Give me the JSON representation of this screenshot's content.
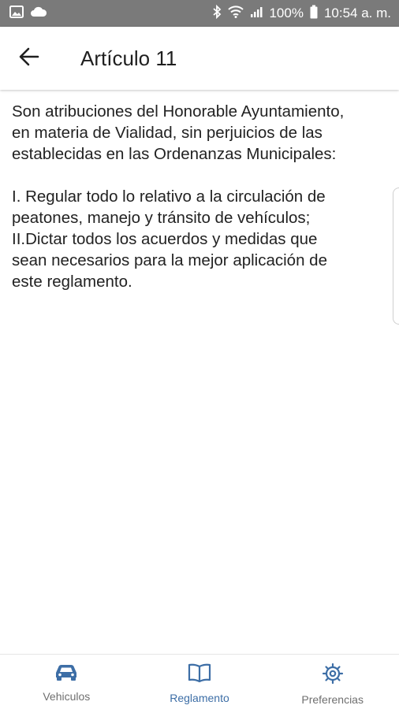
{
  "status_bar": {
    "battery": "100%",
    "time": "10:54 a. m.",
    "icons": [
      "image-icon",
      "cloud-icon",
      "bluetooth-icon",
      "wifi-icon",
      "signal-icon",
      "battery-icon"
    ]
  },
  "app_bar": {
    "back_icon": "arrow-back-icon",
    "title": "Artículo 11"
  },
  "article": {
    "intro": "Son atribuciones del Honorable Ayuntamiento,\nen materia de Vialidad, sin perjuicios de las\nestablecidas en las Ordenanzas Municipales:",
    "items": [
      "I. Regular todo lo relativo a la circulación de\npeatones, manejo y tránsito de vehículos;",
      "II.Dictar todos los acuerdos y medidas que\nsean necesarios para la mejor aplicación de\neste reglamento."
    ]
  },
  "bottom_nav": {
    "items": [
      {
        "label": "Vehiculos",
        "icon": "car-icon",
        "active": false
      },
      {
        "label": "Reglamento",
        "icon": "book-icon",
        "active": true
      },
      {
        "label": "Preferencias",
        "icon": "gear-icon",
        "active": false
      }
    ]
  },
  "colors": {
    "accent": "#3d6ea6",
    "status_bar": "#7a7a7a",
    "inactive": "#6f6f6f"
  }
}
